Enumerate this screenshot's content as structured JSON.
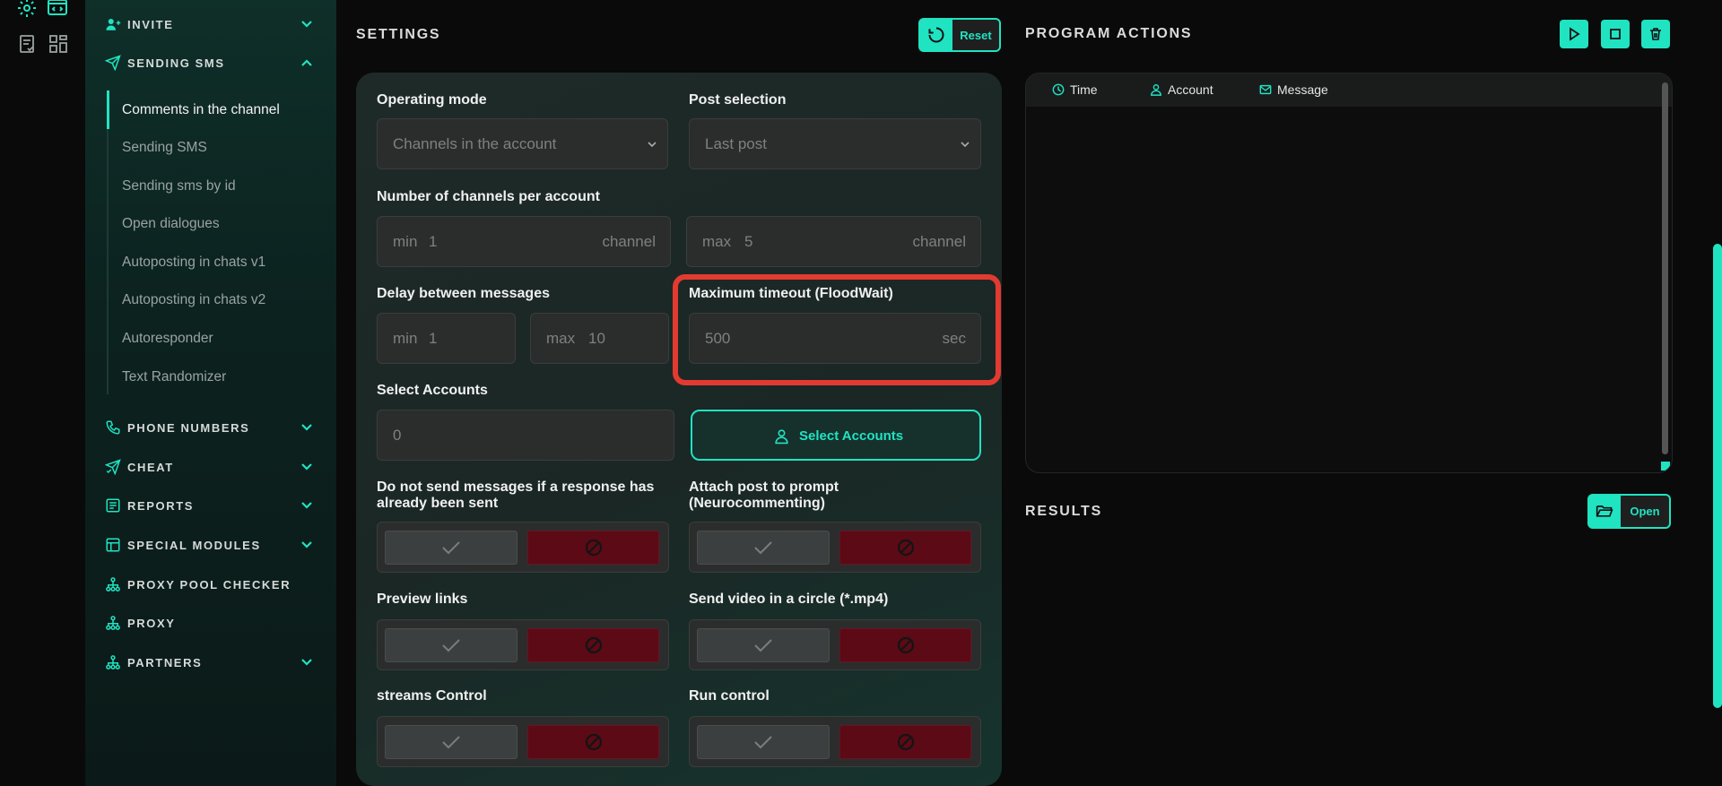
{
  "sidebar": {
    "sections": [
      {
        "label": "INVITE",
        "icon": "user-plus-icon",
        "expanded": false
      },
      {
        "label": "SENDING SMS",
        "icon": "paper-plane-icon",
        "expanded": true
      },
      {
        "label": "PHONE NUMBERS",
        "icon": "phone-icon",
        "expanded": false
      },
      {
        "label": "CHEAT",
        "icon": "send-check-icon",
        "expanded": false
      },
      {
        "label": "REPORTS",
        "icon": "report-icon",
        "expanded": false
      },
      {
        "label": "SPECIAL MODULES",
        "icon": "modules-icon",
        "expanded": false
      },
      {
        "label": "PROXY POOL CHECKER",
        "icon": "network-icon"
      },
      {
        "label": "PROXY",
        "icon": "network-icon"
      },
      {
        "label": "PARTNERS",
        "icon": "network-icon",
        "expanded": false
      }
    ],
    "subitems": [
      "Comments in the channel",
      "Sending SMS",
      "Sending sms by id",
      "Open dialogues",
      "Autoposting in chats v1",
      "Autoposting in chats v2",
      "Autoresponder",
      "Text Randomizer"
    ],
    "active_subitem": "Comments in the channel"
  },
  "settings": {
    "title": "SETTINGS",
    "reset_label": "Reset",
    "operating_mode": {
      "label": "Operating mode",
      "value": "Channels in the account"
    },
    "post_selection": {
      "label": "Post selection",
      "value": "Last post"
    },
    "channels_per_account": {
      "label": "Number of channels per account",
      "min_prefix": "min",
      "min_value": "1",
      "min_suffix": "channel",
      "max_prefix": "max",
      "max_value": "5",
      "max_suffix": "channel"
    },
    "delay": {
      "label": "Delay between messages",
      "min_prefix": "min",
      "min_value": "1",
      "max_prefix": "max",
      "max_value": "10"
    },
    "floodwait": {
      "label": "Maximum timeout (FloodWait)",
      "value": "500",
      "suffix": "sec"
    },
    "select_accounts": {
      "label": "Select Accounts",
      "value": "0",
      "button_label": "Select Accounts"
    },
    "toggles": [
      {
        "label_line1": "Do not send messages if a response has",
        "label_line2": "already been sent"
      },
      {
        "label_line1": "Attach post to prompt",
        "label_line2": "(Neurocommenting)"
      },
      {
        "label_line1": "Preview links",
        "label_line2": ""
      },
      {
        "label_line1": "Send video in a circle (*.mp4)",
        "label_line2": ""
      },
      {
        "label_line1": "streams Control",
        "label_line2": ""
      },
      {
        "label_line1": "Run control",
        "label_line2": ""
      }
    ]
  },
  "program_actions": {
    "title": "PROGRAM ACTIONS",
    "columns": [
      "Time",
      "Account",
      "Message"
    ]
  },
  "results": {
    "title": "RESULTS",
    "open_label": "Open"
  },
  "colors": {
    "accent": "#20e3c2",
    "danger": "#5b0a16",
    "highlight": "#e23a31"
  }
}
